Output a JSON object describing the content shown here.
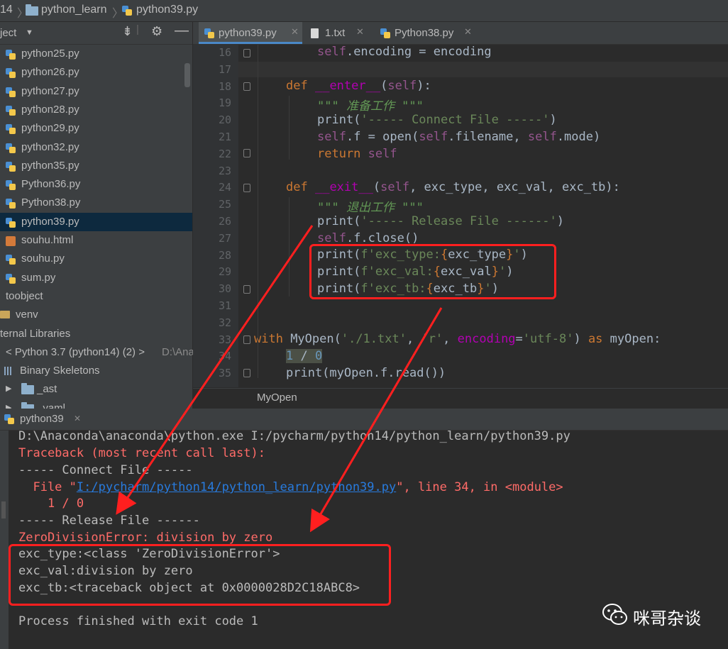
{
  "breadcrumb": {
    "project": "14",
    "folder": "python_learn",
    "file": "python39.py"
  },
  "project_panel": {
    "title": "ject",
    "items": [
      {
        "label": "python25.py",
        "icon": "python-file-icon"
      },
      {
        "label": "python26.py",
        "icon": "python-file-icon"
      },
      {
        "label": "python27.py",
        "icon": "python-file-icon"
      },
      {
        "label": "python28.py",
        "icon": "python-file-icon"
      },
      {
        "label": "python29.py",
        "icon": "python-file-icon"
      },
      {
        "label": "python32.py",
        "icon": "python-file-icon"
      },
      {
        "label": "python35.py",
        "icon": "python-file-icon"
      },
      {
        "label": "Python36.py",
        "icon": "python-file-icon"
      },
      {
        "label": "Python38.py",
        "icon": "python-file-icon"
      },
      {
        "label": "python39.py",
        "icon": "python-file-icon",
        "selected": true
      },
      {
        "label": "souhu.html",
        "icon": "html-file-icon"
      },
      {
        "label": "souhu.py",
        "icon": "python-file-icon"
      },
      {
        "label": "sum.py",
        "icon": "python-file-icon"
      },
      {
        "label": "toobject",
        "icon": "none"
      },
      {
        "label": "venv",
        "icon": "folder-icon"
      },
      {
        "label": "ternal Libraries",
        "icon": "library-icon"
      },
      {
        "label": "< Python 3.7 (python14) (2) >",
        "extra": "D:\\Ana",
        "icon": "python-sdk-icon"
      },
      {
        "label": "Binary Skeletons",
        "icon": "library-icon"
      },
      {
        "label": "_ast",
        "icon": "folder-icon"
      },
      {
        "label": "_yaml",
        "icon": "folder-icon"
      }
    ]
  },
  "tabs": [
    {
      "label": "python39.py",
      "active": true,
      "icon": "python-file-icon"
    },
    {
      "label": "1.txt",
      "active": false,
      "icon": "text-file-icon"
    },
    {
      "label": "Python38.py",
      "active": false,
      "icon": "python-file-icon"
    }
  ],
  "editor": {
    "line_numbers": [
      "16",
      "17",
      "18",
      "19",
      "20",
      "21",
      "22",
      "23",
      "24",
      "25",
      "26",
      "27",
      "28",
      "29",
      "30",
      "31",
      "32",
      "33",
      "34",
      "35"
    ],
    "structure_label": "MyOpen"
  },
  "run_panel": {
    "tab_label": "python39",
    "console_lines": [
      "D:\\Anaconda\\anaconda\\python.exe I:/pycharm/python14/python_learn/python39.py",
      "Traceback (most recent call last):",
      "----- Connect File -----",
      "  File \"",
      "I:/pycharm/python14/python_learn/python39.py",
      "\", line 34, in <module>",
      "    1 / 0",
      "----- Release File ------",
      "ZeroDivisionError: division by zero",
      "exc_type:<class 'ZeroDivisionError'>",
      "exc_val:division by zero",
      "exc_tb:<traceback object at 0x0000028D2C18ABC8>",
      "Process finished with exit code 1"
    ]
  },
  "watermark": {
    "text": "咪哥杂谈",
    "icon": "wechat-icon"
  },
  "colors": {
    "annotation": "#ff1f1f",
    "selection": "#0d293e",
    "error_text": "#ff6b68",
    "link": "#287bde"
  }
}
